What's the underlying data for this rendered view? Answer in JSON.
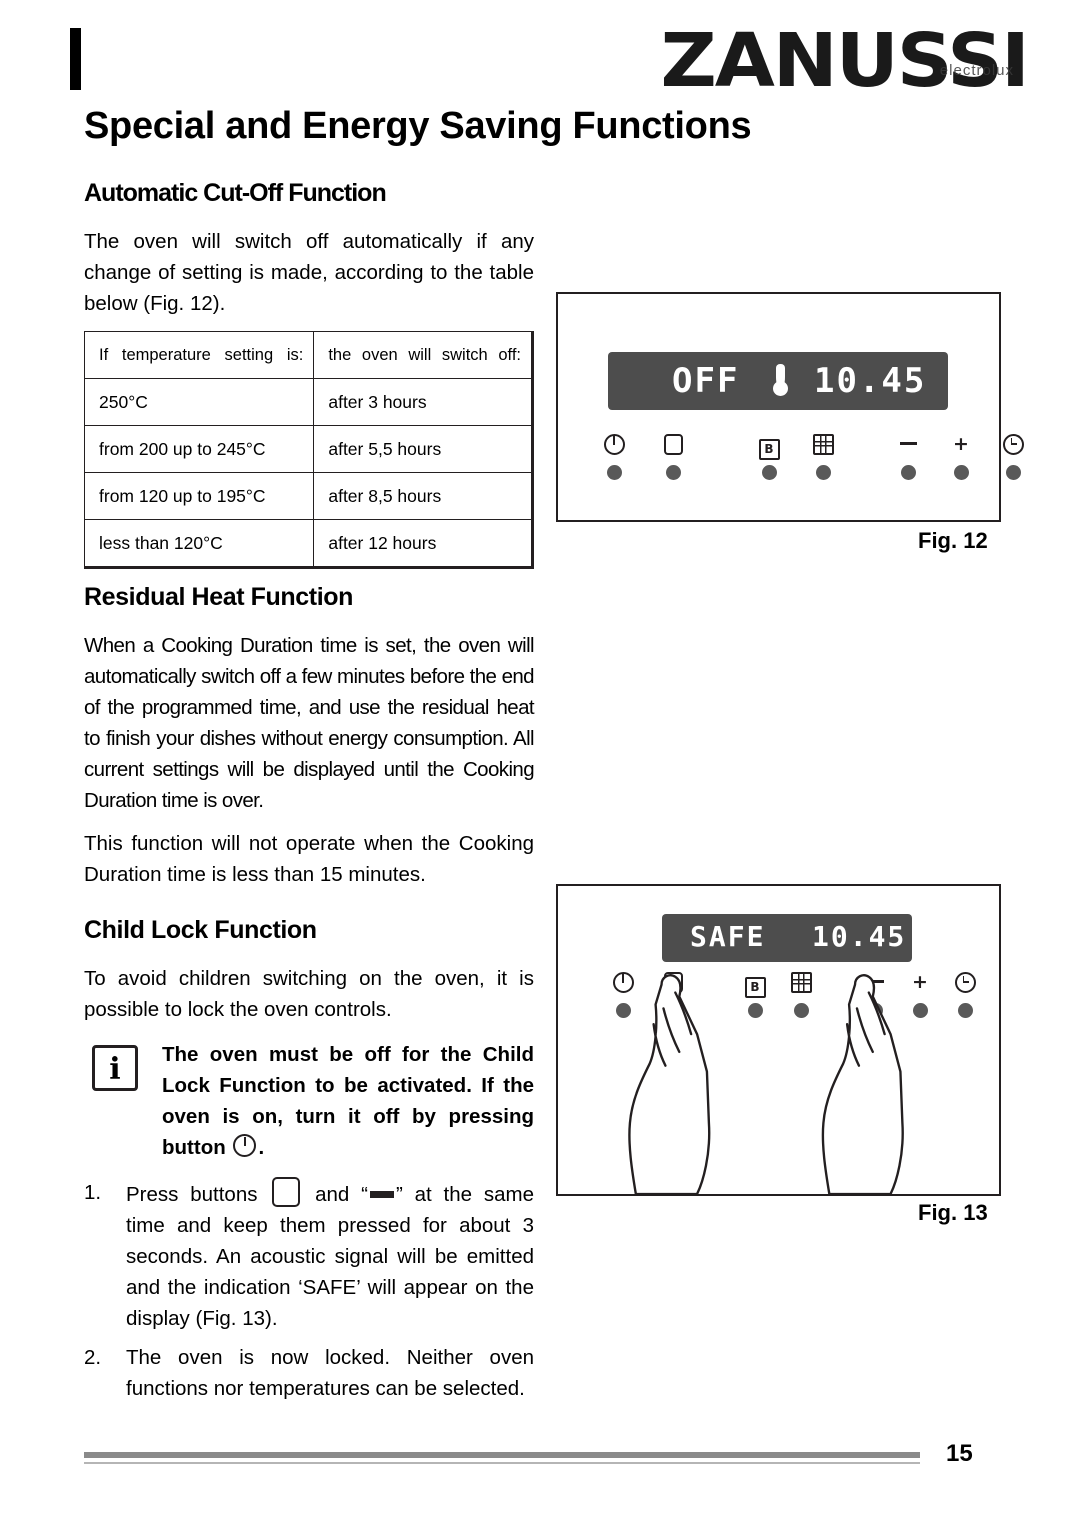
{
  "header": {
    "brand": "ZANUSSI",
    "brand_sub": "electrolux",
    "title": "Special and Energy Saving Functions"
  },
  "sections": {
    "cutoff": {
      "heading": "Automatic Cut-Off Function",
      "intro": "The oven will switch off automatically if any change of setting is made, according to the table below (Fig. 12).",
      "table": {
        "col1_header": "If temperature setting is:",
        "col2_header": "the oven will switch off:",
        "rows": [
          {
            "temp": "250°C",
            "time": "after 3 hours"
          },
          {
            "temp": "from 200 up to 245°C",
            "time": "after 5,5 hours"
          },
          {
            "temp": "from 120 up to 195°C",
            "time": "after 8,5 hours"
          },
          {
            "temp": "less than 120°C",
            "time": "after 12 hours"
          }
        ]
      }
    },
    "residual": {
      "heading": "Residual Heat Function",
      "para1": "When a Cooking Duration time is set, the oven will automatically switch off a few minutes before the end of the programmed time, and use the residual heat to finish your dishes without energy consumption. All current settings will be displayed until the Cooking Duration time is over.",
      "para2": "This function will not operate when the Cooking Duration time is less than 15 minutes."
    },
    "childlock": {
      "heading": "Child Lock Function",
      "para1": "To avoid children switching on the oven, it is possible to lock the oven controls.",
      "note_part1": "The oven must be off for the Child Lock Function to be activated. If the oven is on, turn it off by pressing button",
      "note_part2": ".",
      "steps": [
        {
          "num": "1.",
          "text_a": "Press buttons",
          "text_b": "and “",
          "text_c": "” at the same time and keep them pressed for about 3 seconds. An acoustic signal  will be emitted and the indication ‘SAFE’ will appear on the display (Fig. 13)."
        },
        {
          "num": "2.",
          "text_a": "The oven is now locked. Neither oven functions nor temperatures can be selected.",
          "text_b": "",
          "text_c": ""
        }
      ]
    }
  },
  "figures": {
    "fig12": {
      "caption": "Fig.  12",
      "display_left": "OFF",
      "display_right": "10.45",
      "controls": [
        "power-icon",
        "square-icon",
        "b-icon",
        "grid-icon",
        "minus-icon",
        "plus-icon",
        "clock-icon"
      ]
    },
    "fig13": {
      "caption": "Fig.  13",
      "display_left": "SAFE",
      "display_right": "10.45",
      "controls": [
        "power-icon",
        "square-icon",
        "b-icon",
        "grid-icon",
        "minus-icon",
        "plus-icon",
        "clock-icon"
      ]
    }
  },
  "footer": {
    "page_number": "15"
  },
  "colors": {
    "ink": "#231f20",
    "display_bg": "#4d4d4d",
    "button_dot": "#595959",
    "rule": "#8a8a8a"
  }
}
